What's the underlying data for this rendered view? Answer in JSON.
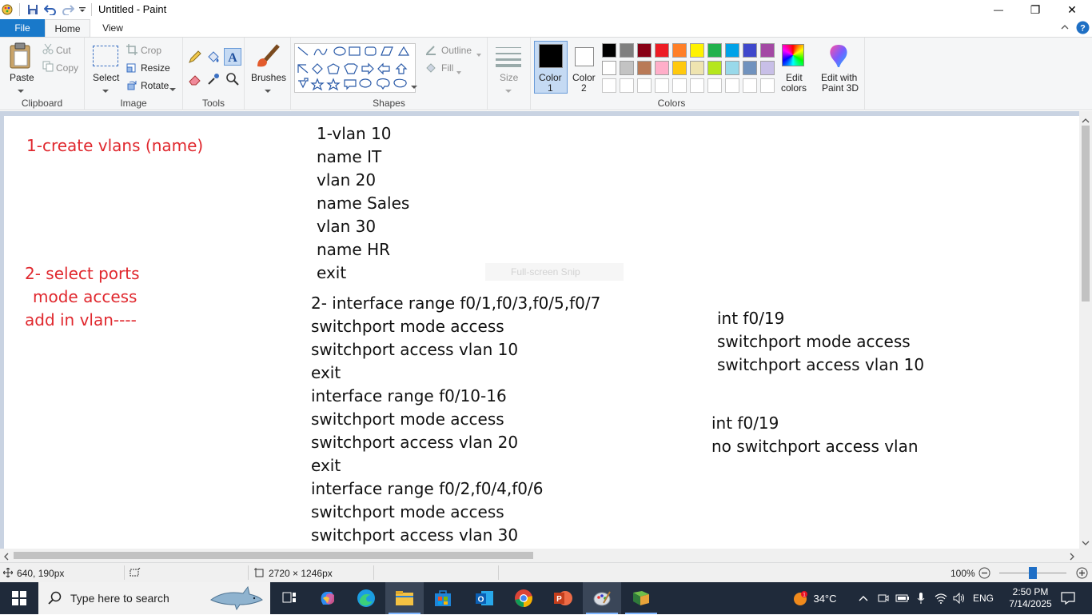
{
  "window": {
    "title": "Untitled - Paint",
    "minimize": "—",
    "maximize": "❐",
    "close": "✕"
  },
  "ribbon_tabs": [
    "File",
    "Home",
    "View"
  ],
  "ribbon": {
    "clipboard": {
      "paste": "Paste",
      "cut": "Cut",
      "copy": "Copy",
      "label": "Clipboard"
    },
    "image": {
      "select": "Select",
      "crop": "Crop",
      "resize": "Resize",
      "rotate": "Rotate",
      "label": "Image"
    },
    "tools": {
      "label": "Tools"
    },
    "brushes": {
      "label": "Brushes"
    },
    "shapes": {
      "outline": "Outline",
      "fill": "Fill",
      "label": "Shapes"
    },
    "size": {
      "label": "Size"
    },
    "colors": {
      "color1_line1": "Color",
      "color1_line2": "1",
      "color2_line1": "Color",
      "color2_line2": "2",
      "edit_colors_line1": "Edit",
      "edit_colors_line2": "colors",
      "label": "Colors",
      "color1": "#000000",
      "color2": "#ffffff",
      "palette_row1": [
        "#000000",
        "#7f7f7f",
        "#880015",
        "#ed1c24",
        "#ff7f27",
        "#fff200",
        "#22b14c",
        "#00a2e8",
        "#3f48cc",
        "#a349a4"
      ],
      "palette_row2": [
        "#ffffff",
        "#c3c3c3",
        "#b97a57",
        "#ffaec9",
        "#ffc90e",
        "#efe4b0",
        "#b5e61d",
        "#99d9ea",
        "#7092be",
        "#c8bfe7"
      ]
    },
    "paint3d": {
      "line1": "Edit with",
      "line2": "Paint 3D"
    }
  },
  "canvas": {
    "left_notes": [
      "1-create vlans  (name)",
      "2- select ports",
      "mode access",
      "add in vlan----"
    ],
    "col1": [
      "1-vlan 10",
      "name IT",
      "vlan 20",
      "name Sales",
      "vlan 30",
      "name HR",
      "exit"
    ],
    "col2": [
      "2- interface range f0/1,f0/3,f0/5,f0/7",
      "switchport mode access",
      "switchport access vlan 10",
      "exit",
      "interface range f0/10-16",
      "switchport mode access",
      "switchport access vlan 20",
      "exit",
      "interface range f0/2,f0/4,f0/6",
      "switchport mode access",
      "switchport access vlan 30"
    ],
    "right_block1": [
      "int f0/19",
      "switchport mode access",
      "switchport access vlan 10"
    ],
    "right_block2": [
      "int f0/19",
      "no switchport access vlan"
    ],
    "snip_overlay": "Full-screen Snip"
  },
  "statusbar": {
    "cursor_pos": "640, 190px",
    "canvas_size": "2720 × 1246px",
    "zoom": "100%",
    "zoom_level": 0.5
  },
  "taskbar": {
    "search_placeholder": "Type here to search",
    "weather": "34°C",
    "language": "ENG",
    "time": "2:50 PM",
    "date": "7/14/2025"
  }
}
